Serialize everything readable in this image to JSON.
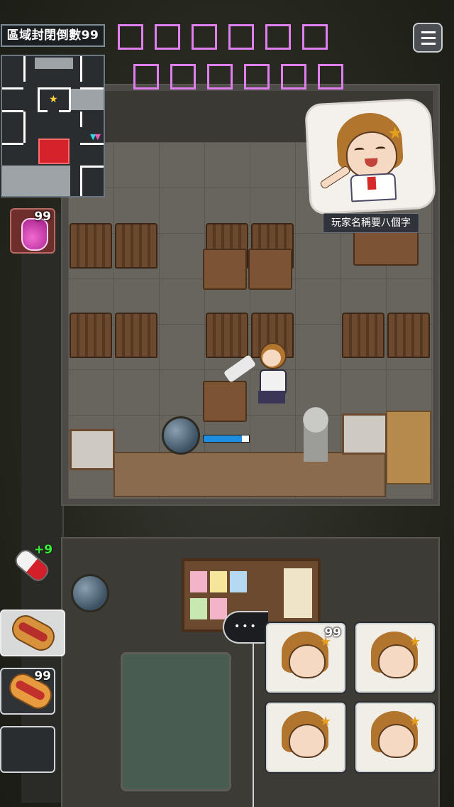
{
  "hud": {
    "countdown_label": "區域封閉倒數99",
    "name_boxes_row1": [
      "□",
      "□",
      "□",
      "□",
      "□",
      "□"
    ],
    "name_boxes_row2": [
      "□",
      "□",
      "□",
      "□",
      "□",
      "□"
    ],
    "menu_icon": "menu-icon",
    "player_name": "玩家名稱要八個字"
  },
  "colors": {
    "name_box_border": "#e07ff0",
    "minimap_alert": "#d6232b",
    "heal_plus": "#3bf03b",
    "progress_fill": "#1e8fe0"
  },
  "player": {
    "progress_fraction": 0.85
  },
  "items": {
    "potion_count": "99",
    "pill_bonus": "+9",
    "hotdog_count": "99"
  },
  "cards": {
    "more_label": "•••",
    "first_card_count": "99"
  }
}
